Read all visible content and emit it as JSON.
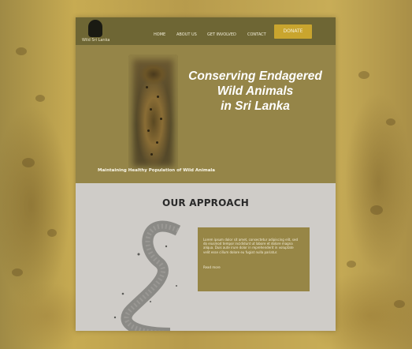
{
  "brand": {
    "logo_text": "Wild Sri Lanka",
    "logo_icon": "leopard-logo-icon"
  },
  "nav": {
    "home": "HOME",
    "about": "ABOUT US",
    "get_involved": "GET INVOLVED",
    "contact": "CONTACT"
  },
  "donate_label": "DONATE",
  "hero": {
    "title_line1": "Conserving Endagered",
    "title_line2": "Wild Animals",
    "title_line3": "in Sri Lanka",
    "subtitle": "Maintaining  Healthy Population of Wild Animala"
  },
  "approach": {
    "title": "OUR APPROACH",
    "body": "Lorem ipsum dolor sit amet, consectetur adipiscing elit, sed do eiusmod tempor incididunt ut labore et dolore magna aliqua. Duis aute irure dolor in reprehenderit in voluptate velit esse cillum dolore eu fugiat nulla pariatur.",
    "link": "Read more"
  },
  "colors": {
    "topbar": "#6e6634",
    "hero_bg": "#958548",
    "accent": "#c9a52e",
    "section_bg": "#cfccc8",
    "card_bg": "#978646"
  }
}
